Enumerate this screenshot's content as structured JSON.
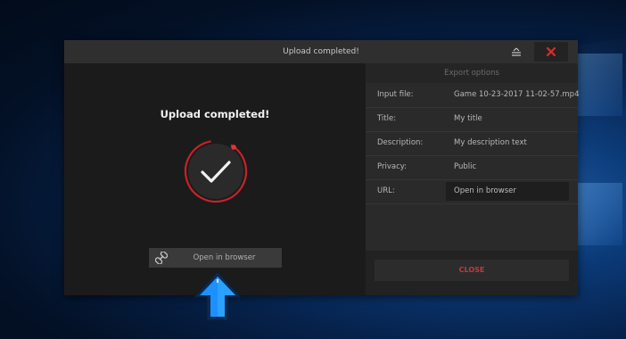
{
  "window": {
    "title": "Upload completed!",
    "icons": {
      "minimize": "minimize-icon",
      "close": "close-x-icon"
    }
  },
  "left_panel": {
    "heading": "Upload completed!",
    "status_icon": "check-circle-icon",
    "open_browser_button": {
      "label": "Open in browser",
      "icon": "link-icon"
    }
  },
  "export_options": {
    "header": "Export options",
    "rows": [
      {
        "label": "Input file:",
        "value": "Game 10-23-2017 11-02-57.mp4"
      },
      {
        "label": "Title:",
        "value": "My title"
      },
      {
        "label": "Description:",
        "value": "My description text"
      },
      {
        "label": "Privacy:",
        "value": "Public"
      }
    ],
    "url": {
      "label": "URL:",
      "value": "Open in browser"
    },
    "close_button": "CLOSE"
  },
  "colors": {
    "accent_red": "#d42a2a",
    "window_bg": "#1b1b1b",
    "arrow_blue": "#1e90ff"
  },
  "overlay": {
    "arrow_icon": "up-arrow-icon"
  }
}
